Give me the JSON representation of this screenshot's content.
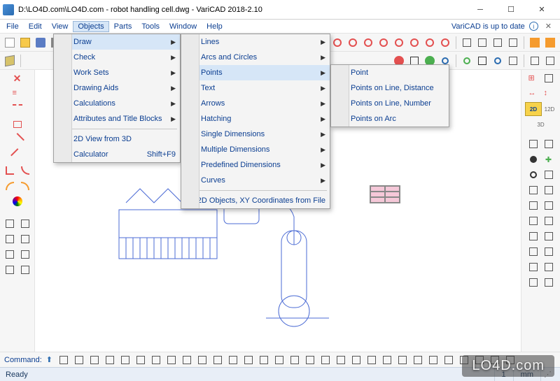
{
  "window": {
    "title": "D:\\LO4D.com\\LO4D.com - robot handling cell.dwg - VariCAD 2018-2.10",
    "update_text": "VariCAD is up to date"
  },
  "menu": {
    "items": [
      "File",
      "Edit",
      "View",
      "Objects",
      "Parts",
      "Tools",
      "Window",
      "Help"
    ],
    "open_index": 3
  },
  "objects_menu": {
    "items": [
      {
        "label": "Draw",
        "submenu": true,
        "hl": true
      },
      {
        "label": "Check",
        "submenu": true
      },
      {
        "label": "Work Sets",
        "submenu": true
      },
      {
        "label": "Drawing Aids",
        "submenu": true
      },
      {
        "label": "Calculations",
        "submenu": true
      },
      {
        "label": "Attributes and Title Blocks",
        "submenu": true
      },
      {
        "divider": true
      },
      {
        "label": "2D View from 3D",
        "icon": "2d3d"
      },
      {
        "label": "Calculator",
        "shortcut": "Shift+F9",
        "icon": "calc"
      }
    ]
  },
  "draw_menu": {
    "items": [
      {
        "label": "Lines",
        "submenu": true
      },
      {
        "label": "Arcs and Circles",
        "submenu": true
      },
      {
        "label": "Points",
        "submenu": true,
        "hl": true
      },
      {
        "label": "Text",
        "submenu": true
      },
      {
        "label": "Arrows",
        "submenu": true,
        "icon": "arrow"
      },
      {
        "label": "Hatching",
        "submenu": true
      },
      {
        "label": "Single Dimensions",
        "submenu": true
      },
      {
        "label": "Multiple Dimensions",
        "submenu": true
      },
      {
        "label": "Predefined Dimensions",
        "submenu": true
      },
      {
        "label": "Curves",
        "submenu": true
      },
      {
        "divider": true
      },
      {
        "label": "2D Objects, XY Coordinates from File",
        "icon": "xy"
      }
    ]
  },
  "points_menu": {
    "items": [
      {
        "label": "Point",
        "icon": "pt"
      },
      {
        "label": "Points on Line, Distance",
        "icon": "ptdist"
      },
      {
        "label": "Points on Line, Number",
        "icon": "ptnum"
      },
      {
        "label": "Points on Arc",
        "icon": "ptarc"
      }
    ]
  },
  "command": {
    "label": "Command:"
  },
  "status": {
    "ready": "Ready",
    "layer": "1",
    "unit": "mm"
  },
  "right_labels": {
    "b2d": "2D",
    "b12d": "12D",
    "b3d": "3D"
  },
  "watermark": "LO4D.com"
}
